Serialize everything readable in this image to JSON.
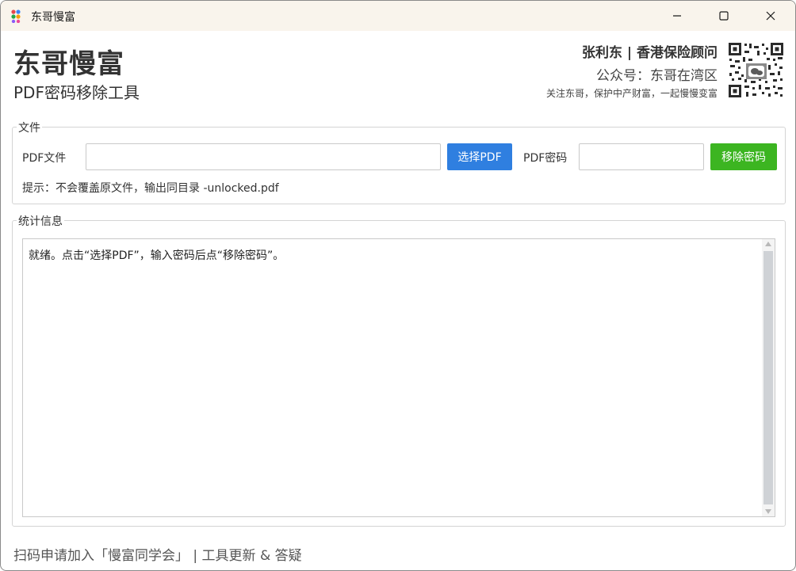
{
  "window": {
    "title": "东哥慢富",
    "icon": "app-dots-icon",
    "controls": [
      "minimize-icon",
      "maximize-icon",
      "close-icon"
    ]
  },
  "header": {
    "brand_title": "东哥慢富",
    "subtitle": "PDF密码移除工具",
    "contact_name": "张利东 | 香港保险顾问",
    "contact_account": "公众号：东哥在湾区",
    "slogan": "关注东哥，保护中产财富，一起慢慢变富",
    "qr_icon": "qr-code-icon"
  },
  "file_group": {
    "legend": "文件",
    "pdf_label": "PDF文件",
    "pdf_value": "",
    "select_button": "选择PDF",
    "password_label": "PDF密码",
    "password_value": "",
    "remove_button": "移除密码",
    "hint": "提示：不会覆盖原文件，输出同目录 -unlocked.pdf"
  },
  "stats_group": {
    "legend": "统计信息",
    "log_text": "就绪。点击“选择PDF”，输入密码后点“移除密码”。"
  },
  "footer": {
    "link_text": "扫码申请加入「慢富同学会」 | 工具更新 & 答疑"
  },
  "colors": {
    "select_button": "#2f7fe0",
    "remove_button": "#3cb521",
    "titlebar": "#f9f4ec"
  }
}
